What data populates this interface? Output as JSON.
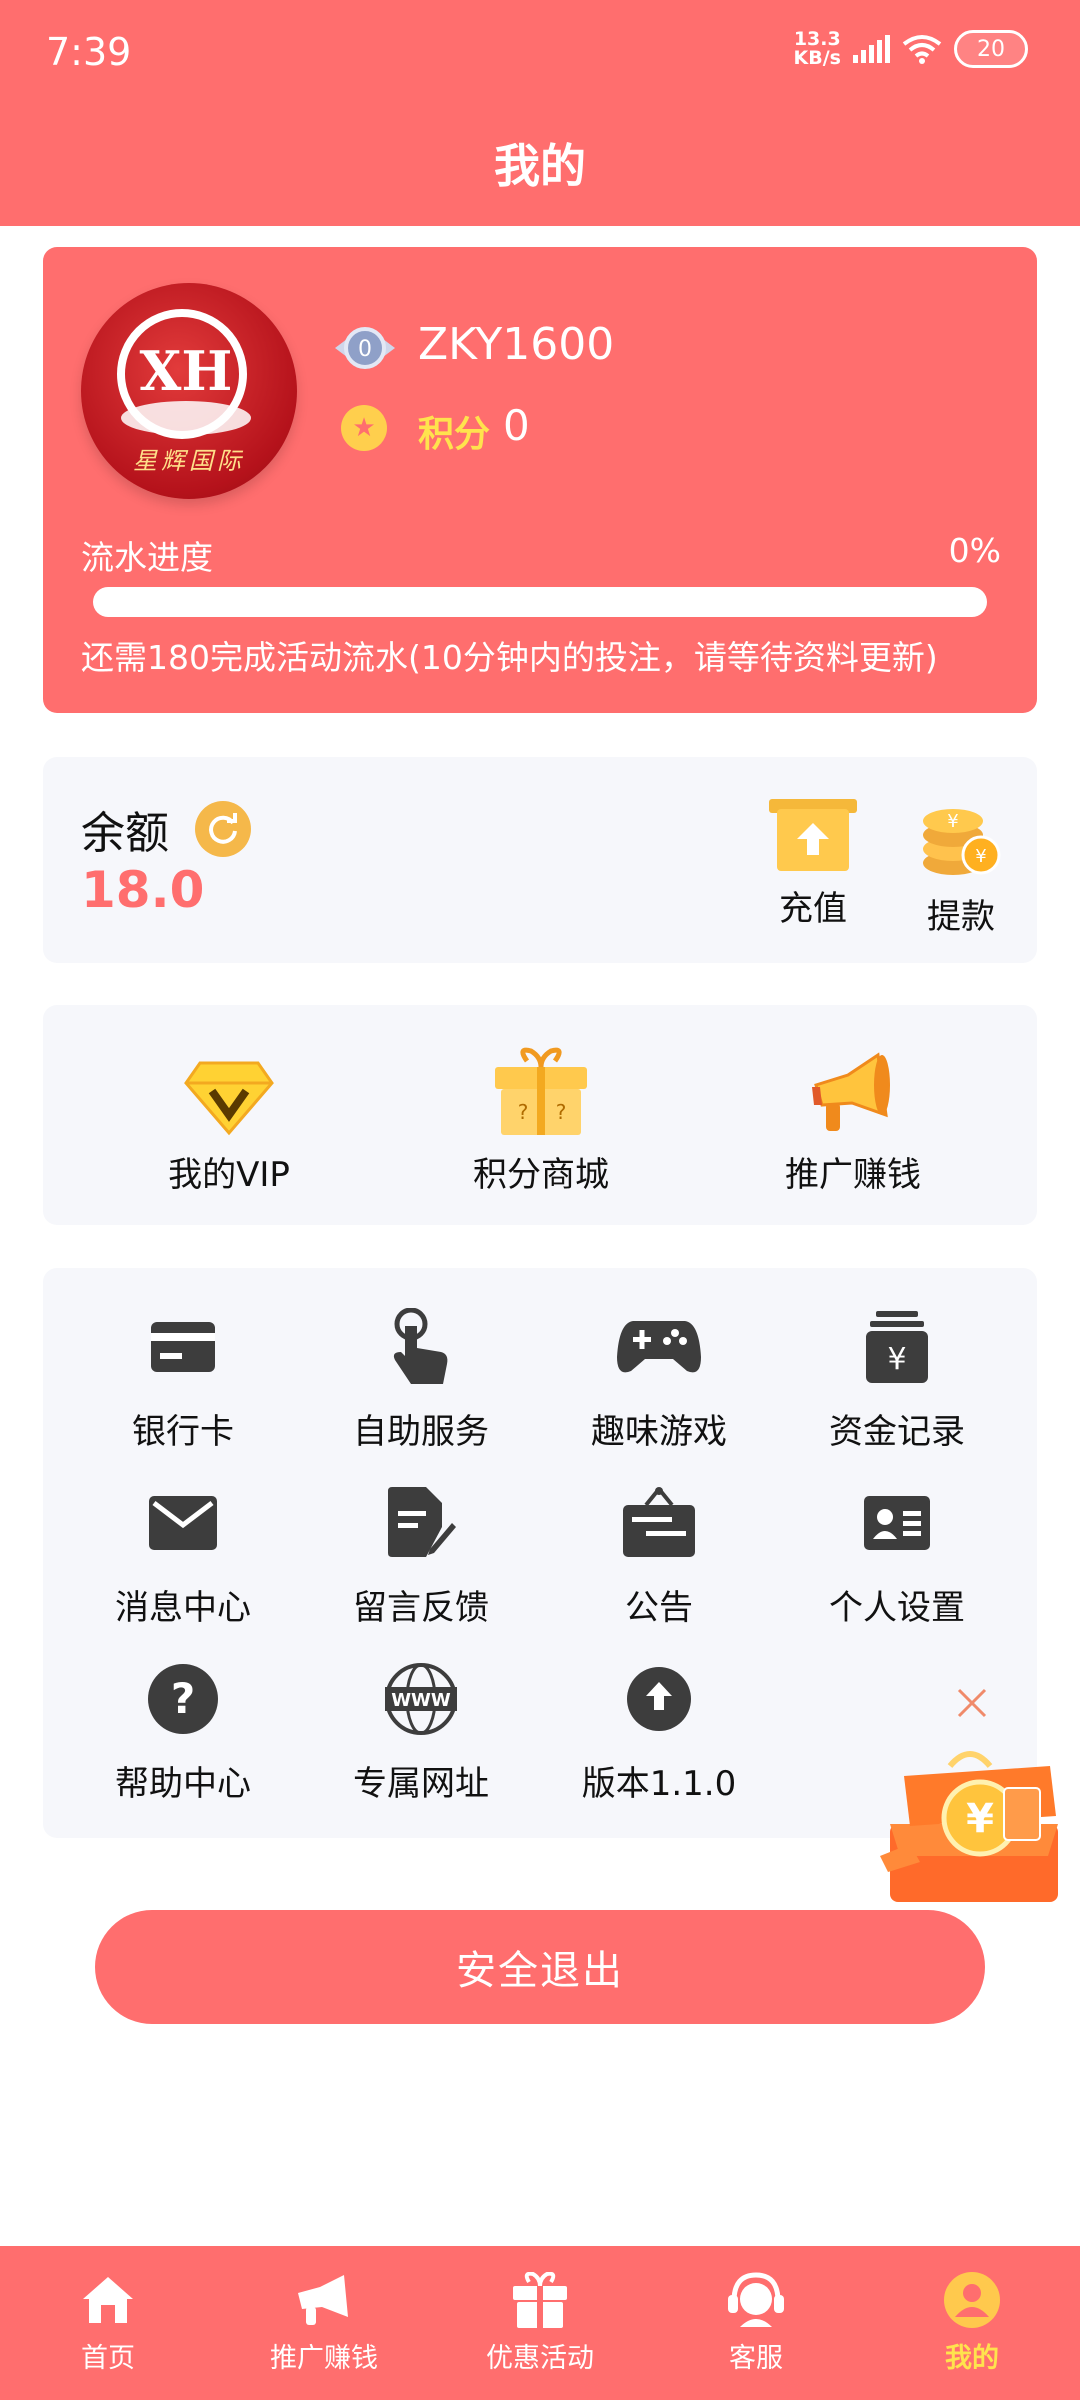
{
  "status_bar": {
    "time": "7:39",
    "net_speed_value": "13.3",
    "net_speed_unit": "KB/s",
    "battery": "20"
  },
  "header": {
    "title": "我的"
  },
  "profile": {
    "avatar_text": "XH",
    "avatar_brand": "星辉国际",
    "level": "0",
    "username": "ZKY1600",
    "points_label": "积分",
    "points_value": "0",
    "flow_label": "流水进度",
    "flow_percent_text": "0%",
    "flow_progress": 0,
    "flow_note": "还需180完成活动流水(10分钟内的投注，请等待资料更新)"
  },
  "balance": {
    "label": "余额",
    "value": "18.0",
    "deposit_label": "充值",
    "withdraw_label": "提款"
  },
  "shortcuts": [
    {
      "label": "我的VIP",
      "icon": "vip-diamond-icon"
    },
    {
      "label": "积分商城",
      "icon": "gift-box-icon"
    },
    {
      "label": "推广赚钱",
      "icon": "megaphone-icon"
    }
  ],
  "menu": [
    {
      "label": "银行卡",
      "icon": "bank-card-icon"
    },
    {
      "label": "自助服务",
      "icon": "hand-pointer-icon"
    },
    {
      "label": "趣味游戏",
      "icon": "gamepad-icon"
    },
    {
      "label": "资金记录",
      "icon": "money-record-icon"
    },
    {
      "label": "消息中心",
      "icon": "envelope-icon"
    },
    {
      "label": "留言反馈",
      "icon": "feedback-icon"
    },
    {
      "label": "公告",
      "icon": "notice-board-icon"
    },
    {
      "label": "个人设置",
      "icon": "id-card-icon"
    },
    {
      "label": "帮助中心",
      "icon": "help-icon"
    },
    {
      "label": "专属网址",
      "icon": "www-globe-icon"
    },
    {
      "label": "版本1.1.0",
      "icon": "version-upload-icon"
    }
  ],
  "logout_label": "安全退出",
  "nav": [
    {
      "label": "首页",
      "icon": "home-icon"
    },
    {
      "label": "推广赚钱",
      "icon": "megaphone-icon"
    },
    {
      "label": "优惠活动",
      "icon": "gift-icon"
    },
    {
      "label": "客服",
      "icon": "headset-icon"
    },
    {
      "label": "我的",
      "icon": "user-icon",
      "active": true
    }
  ],
  "colors": {
    "primary": "#ff6e6e",
    "card_bg": "#f6f7fb",
    "accent_yellow": "#ffe34d",
    "icon_gray": "#3d3d3d"
  }
}
